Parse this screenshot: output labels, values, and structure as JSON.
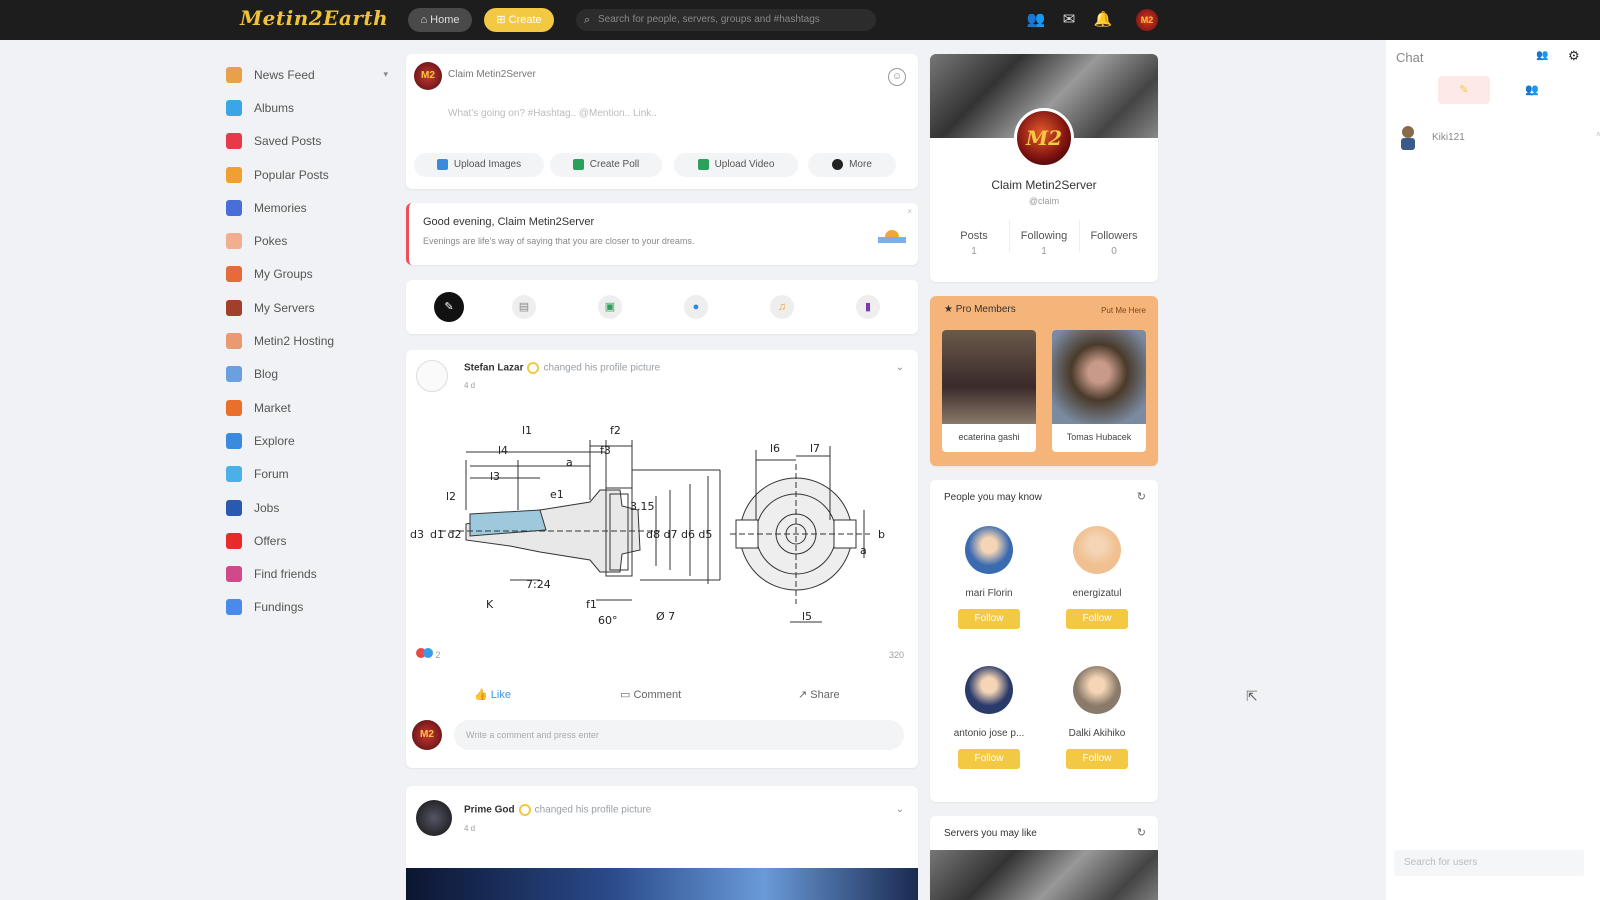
{
  "topbar": {
    "logo": "Metin2Earth",
    "home_label": "Home",
    "create_label": "Create",
    "search_placeholder": "Search for people, servers, groups and #hashtags",
    "avatar_text": "M2"
  },
  "sidebar": {
    "items": [
      {
        "label": "News Feed",
        "color": "#e8a04a",
        "icon": "news-feed-icon"
      },
      {
        "label": "Albums",
        "color": "#3aa6e8",
        "icon": "albums-icon"
      },
      {
        "label": "Saved Posts",
        "color": "#e8394a",
        "icon": "bookmark-icon"
      },
      {
        "label": "Popular Posts",
        "color": "#f0a030",
        "icon": "popular-icon"
      },
      {
        "label": "Memories",
        "color": "#4a6ed8",
        "icon": "memories-icon"
      },
      {
        "label": "Pokes",
        "color": "#f0b090",
        "icon": "pokes-icon"
      },
      {
        "label": "My Groups",
        "color": "#e86a3a",
        "icon": "groups-icon"
      },
      {
        "label": "My Servers",
        "color": "#a0402a",
        "icon": "servers-icon"
      },
      {
        "label": "Metin2 Hosting",
        "color": "#e89a70",
        "icon": "hosting-icon"
      },
      {
        "label": "Blog",
        "color": "#6aa0e0",
        "icon": "blog-icon"
      },
      {
        "label": "Market",
        "color": "#e8702a",
        "icon": "market-icon"
      },
      {
        "label": "Explore",
        "color": "#3a8ae0",
        "icon": "explore-icon"
      },
      {
        "label": "Forum",
        "color": "#4ab0e8",
        "icon": "forum-icon"
      },
      {
        "label": "Jobs",
        "color": "#2a5ab0",
        "icon": "jobs-icon"
      },
      {
        "label": "Offers",
        "color": "#e82a2a",
        "icon": "offers-icon"
      },
      {
        "label": "Find friends",
        "color": "#d04a8a",
        "icon": "find-friends-icon"
      },
      {
        "label": "Fundings",
        "color": "#4a8ae8",
        "icon": "fundings-icon"
      }
    ]
  },
  "composer": {
    "user_name": "Claim Metin2Server",
    "placeholder": "What's going on? #Hashtag.. @Mention.. Link..",
    "actions": [
      {
        "label": "Upload Images",
        "color": "#3a8ae0"
      },
      {
        "label": "Create Poll",
        "color": "#2aa05a"
      },
      {
        "label": "Upload Video",
        "color": "#2aa05a"
      },
      {
        "label": "More",
        "color": "#222222"
      }
    ]
  },
  "greeting": {
    "title": "Good evening, Claim Metin2Server",
    "subtitle": "Evenings are life's way of saying that you are closer to your dreams."
  },
  "post1": {
    "author": "Stefan Lazar",
    "action": "changed his profile picture",
    "time": "4 d",
    "like_label": "Like",
    "comment_label": "Comment",
    "share_label": "Share",
    "views": "320",
    "reactions_count": "2",
    "comment_placeholder": "Write a comment and press enter",
    "drawing_labels": {
      "l1": "l1",
      "l2": "l2",
      "l3": "l3",
      "l4": "l4",
      "l5": "l5",
      "l6": "l6",
      "l7": "l7",
      "f1": "f1",
      "f2": "f2",
      "f3": "f3",
      "a": "a",
      "b": "b",
      "e1": "e1",
      "d1d2": "d1 d2",
      "d8d7d6d5": "d8 d7 d6 d5",
      "ratio": "7:24",
      "angle": "60°",
      "dia": "Ø 7",
      "k": "K",
      "d3": "d3",
      "dim315": "3.15"
    }
  },
  "post2": {
    "author": "Prime God",
    "action": "changed his profile picture",
    "time": "4 d"
  },
  "profile": {
    "name": "Claim Metin2Server",
    "handle": "@claim",
    "avatar_text": "M2",
    "stats": [
      {
        "label": "Posts",
        "value": "1"
      },
      {
        "label": "Following",
        "value": "1"
      },
      {
        "label": "Followers",
        "value": "0"
      }
    ]
  },
  "pro_members": {
    "title": "Pro Members",
    "cta": "Put Me Here",
    "members": [
      {
        "name": "ecaterina gashi"
      },
      {
        "name": "Tomas Hubacek"
      }
    ]
  },
  "people": {
    "title": "People you may know",
    "follow_label": "Follow",
    "items": [
      {
        "name": "mari Florin",
        "color": "#3a6ab0"
      },
      {
        "name": "energizatul",
        "color": "#f0c090"
      },
      {
        "name": "antonio jose p...",
        "color": "#2a3a6a"
      },
      {
        "name": "Dalki Akihiko",
        "color": "#8a7a6a"
      }
    ]
  },
  "servers": {
    "title": "Servers you may like"
  },
  "chat": {
    "title": "Chat",
    "users": [
      {
        "name": "Kiki121"
      }
    ],
    "search_placeholder": "Search for users"
  }
}
